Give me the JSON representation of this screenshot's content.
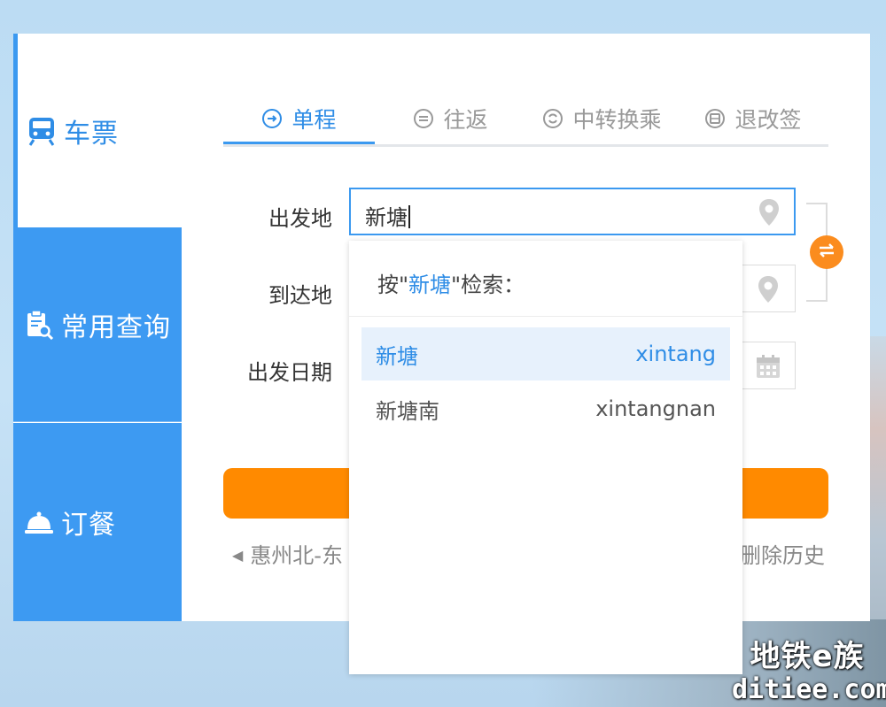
{
  "sidebar": {
    "items": [
      {
        "label": "车票",
        "icon": "train-icon",
        "active": true
      },
      {
        "label": "常用查询",
        "icon": "clipboard-search-icon",
        "active": false
      },
      {
        "label": "订餐",
        "icon": "food-cloche-icon",
        "active": false
      }
    ]
  },
  "tabs": [
    {
      "label": "单程",
      "icon": "arrow-right-circle-icon",
      "active": true
    },
    {
      "label": "往返",
      "icon": "equals-circle-icon",
      "active": false
    },
    {
      "label": "中转换乘",
      "icon": "transfer-circle-icon",
      "active": false
    },
    {
      "label": "退改签",
      "icon": "ticket-circle-icon",
      "active": false
    }
  ],
  "form": {
    "from_label": "出发地",
    "from_value": "新塘",
    "to_label": "到达地",
    "date_label": "出发日期"
  },
  "history": {
    "item": "惠州北-东",
    "delete_label": "删除历史"
  },
  "dropdown": {
    "head_prefix": "按\"",
    "head_keyword": "新塘",
    "head_suffix": "\"检索：",
    "results": [
      {
        "name": "新塘",
        "pinyin": "xintang",
        "highlighted": true
      },
      {
        "name": "新塘南",
        "pinyin": "xintangnan",
        "highlighted": false
      }
    ]
  },
  "watermark": {
    "line1": "地铁e族",
    "line2": "ditiee.com"
  },
  "colors": {
    "accent": "#3b99f0",
    "search_button": "#ff8a00",
    "swap_button": "#fb8c1e"
  }
}
